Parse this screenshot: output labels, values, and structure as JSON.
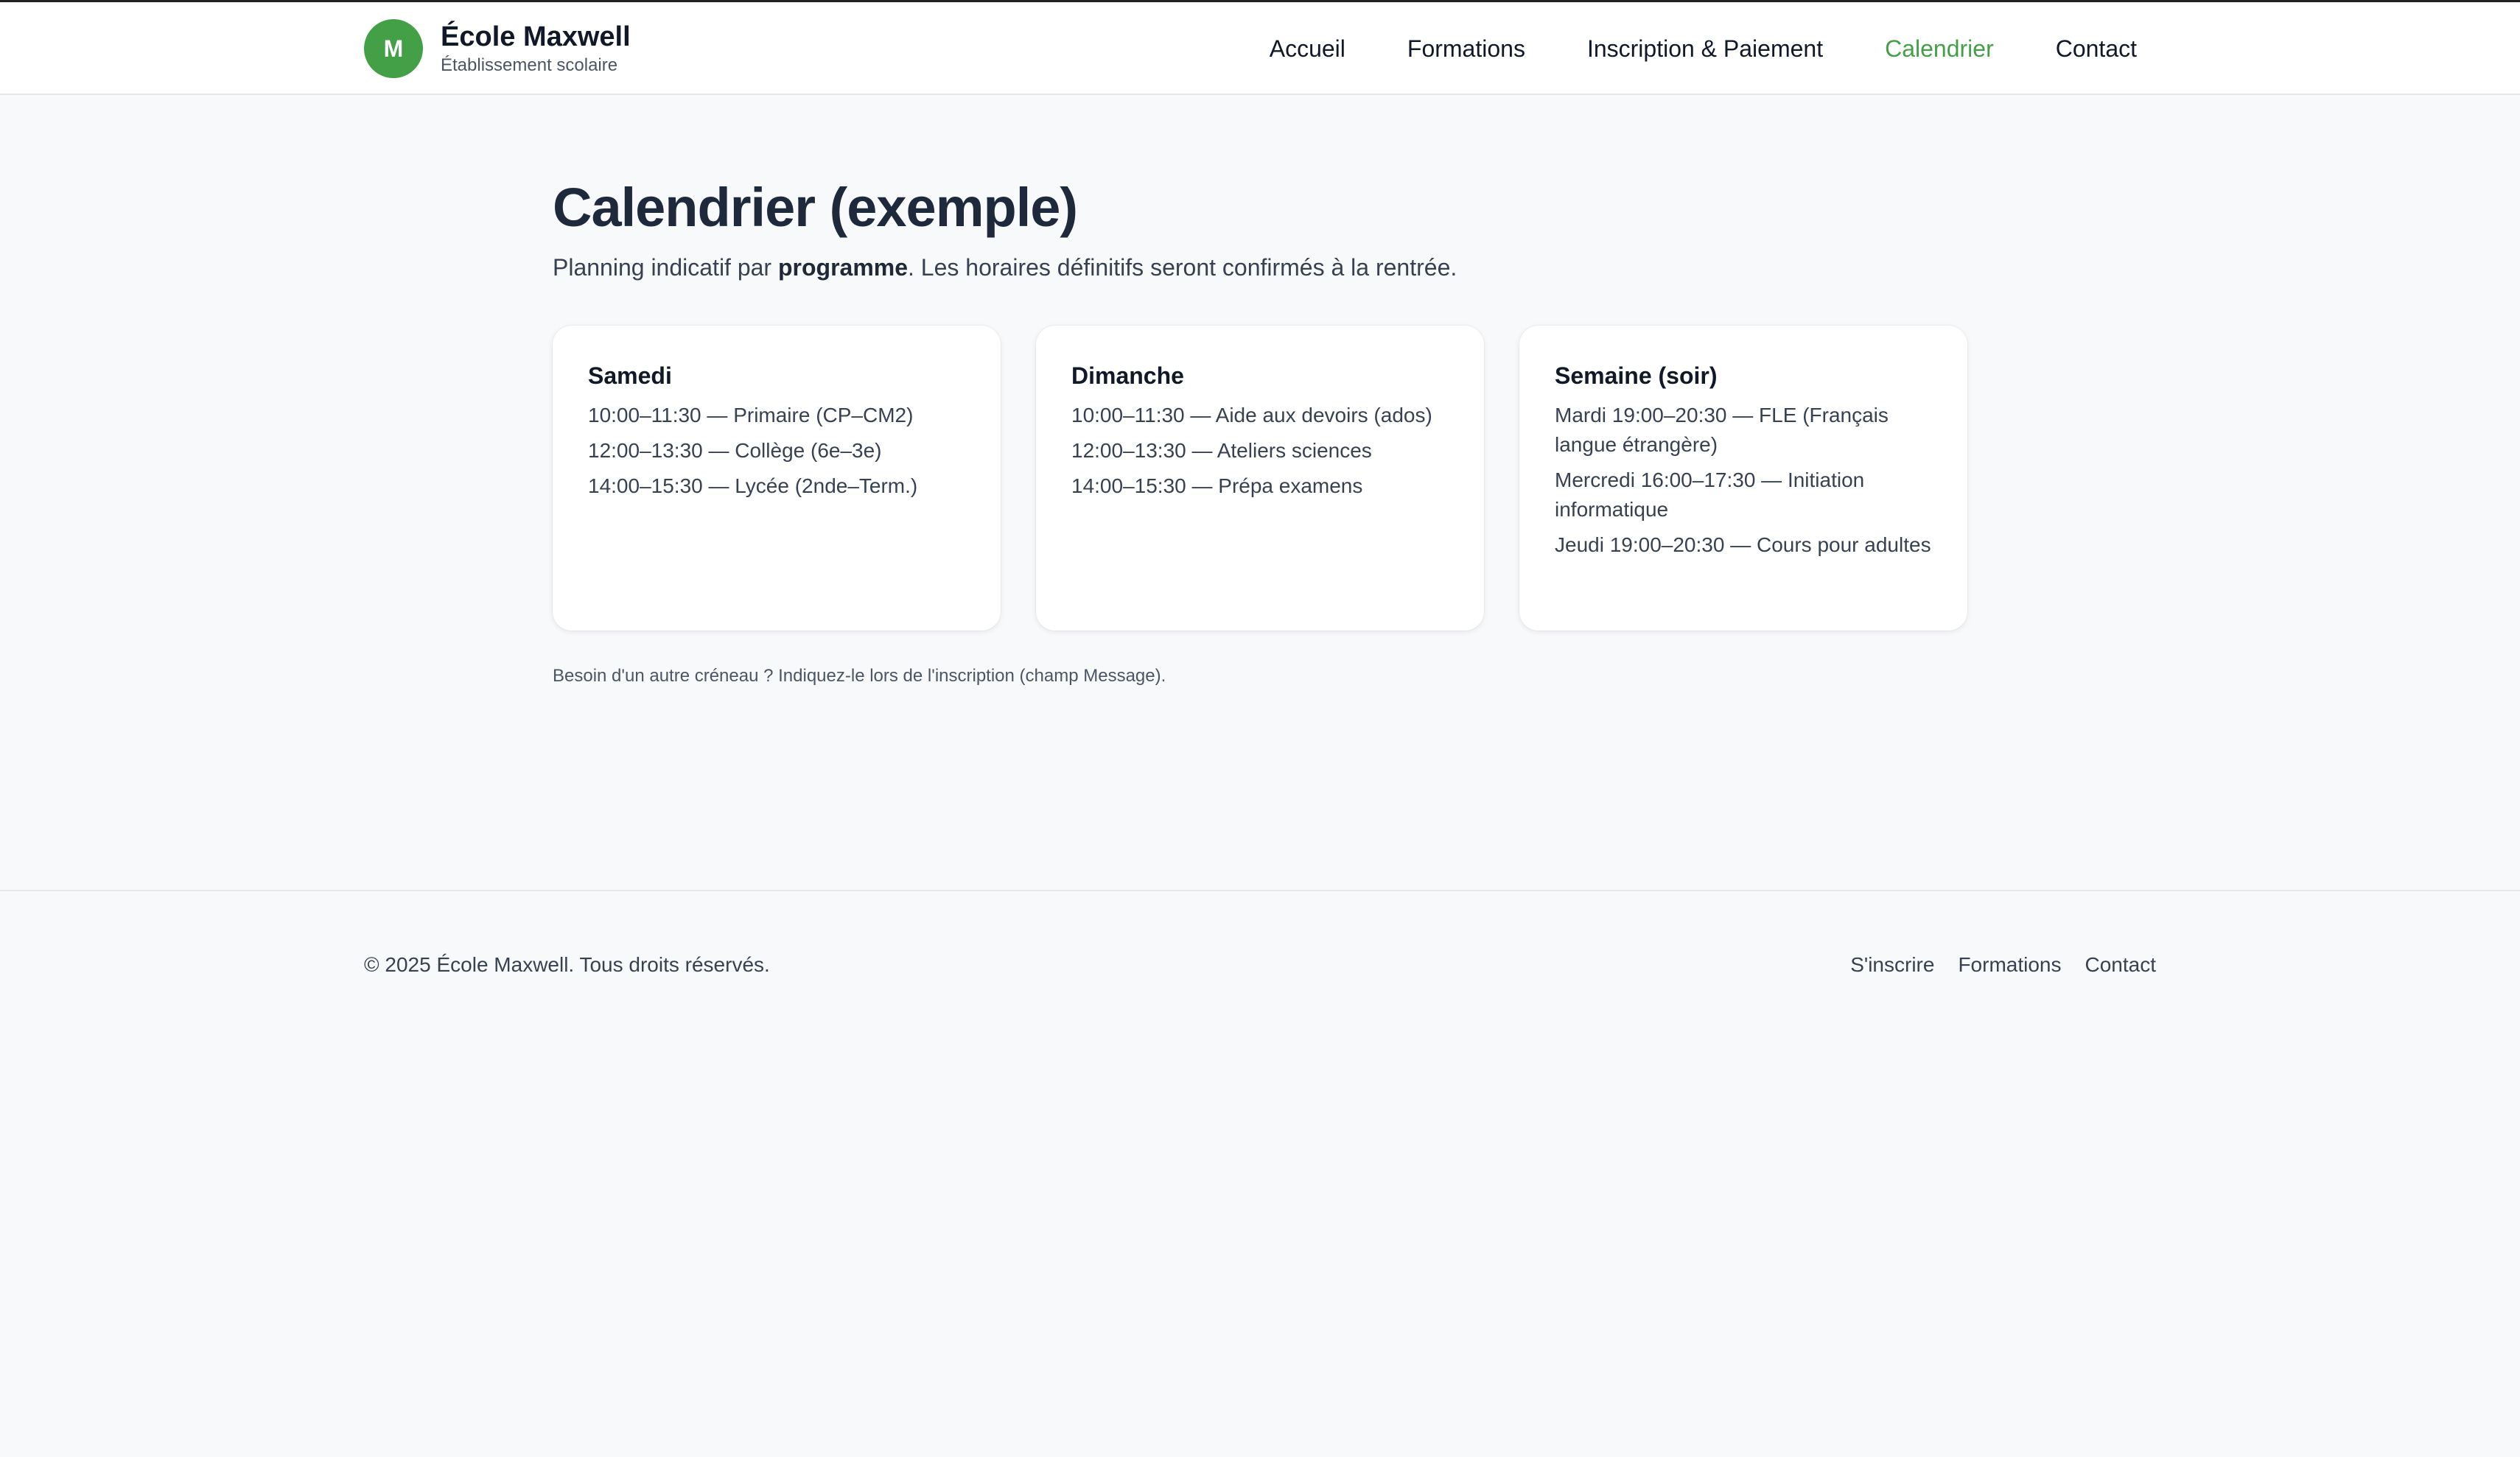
{
  "header": {
    "logo_letter": "M",
    "school_name": "École Maxwell",
    "school_subtitle": "Établissement scolaire",
    "nav": [
      "Accueil",
      "Formations",
      "Inscription & Paiement",
      "Calendrier",
      "Contact"
    ],
    "active_nav": "Calendrier"
  },
  "main": {
    "title": "Calendrier (exemple)",
    "intro_before": "Planning indicatif par ",
    "intro_bold": "programme",
    "intro_after": ". Les horaires définitifs seront confirmés à la rentrée.",
    "cards": [
      {
        "title": "Samedi",
        "items": [
          "10:00–11:30 — Primaire (CP–CM2)",
          "12:00–13:30 — Collège (6e–3e)",
          "14:00–15:30 — Lycée (2nde–Term.)"
        ]
      },
      {
        "title": "Dimanche",
        "items": [
          "10:00–11:30 — Aide aux devoirs (ados)",
          "12:00–13:30 — Ateliers sciences",
          "14:00–15:30 — Prépa examens"
        ]
      },
      {
        "title": "Semaine (soir)",
        "items": [
          "Mardi 19:00–20:30 — FLE (Français langue étrangère)",
          "Mercredi 16:00–17:30 — Initiation informatique",
          "Jeudi 19:00–20:30 — Cours pour adultes"
        ]
      }
    ],
    "note": "Besoin d'un autre créneau ? Indiquez-le lors de l'inscription (champ Message)."
  },
  "footer": {
    "copyright": "© 2025 École Maxwell. Tous droits réservés.",
    "links": [
      "S'inscrire",
      "Formations",
      "Contact"
    ]
  },
  "colors": {
    "accent": "#43a047",
    "background": "#f8f9fb",
    "card": "#ffffff",
    "text": "#1f2937"
  }
}
